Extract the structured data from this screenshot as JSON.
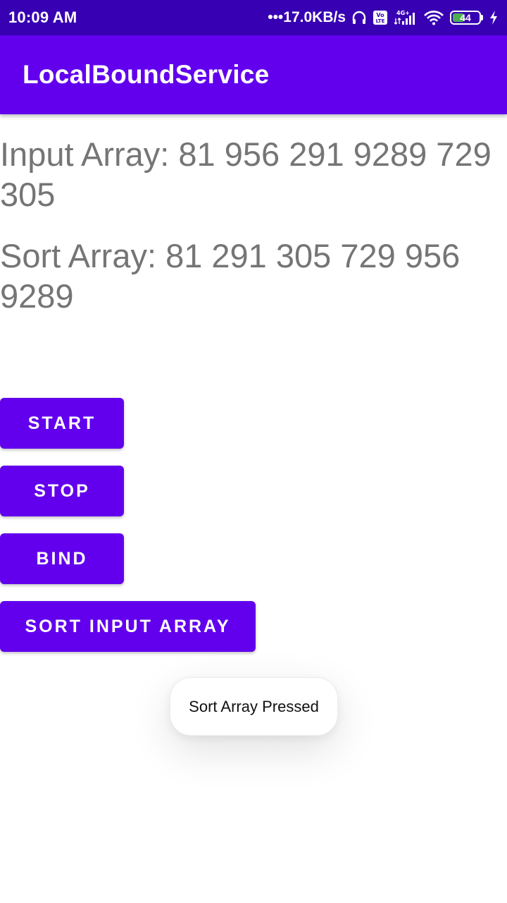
{
  "status_bar": {
    "time": "10:09 AM",
    "network_speed": "•••17.0KB/s",
    "battery_level": "44",
    "icons": [
      "headphones-icon",
      "volte-icon",
      "signal-4g-icon",
      "wifi-icon",
      "battery-icon",
      "charging-bolt-icon"
    ]
  },
  "app_bar": {
    "title": "LocalBoundService"
  },
  "main": {
    "input_array": "Input Array:  81 956 291 9289 729 305",
    "sort_array": "Sort Array:  81 291 305 729 956 9289"
  },
  "buttons": {
    "start": "START",
    "stop": "STOP",
    "bind": "BIND",
    "sort": "SORT INPUT ARRAY"
  },
  "toast": {
    "message": "Sort Array Pressed"
  },
  "colors": {
    "status_bar": "#3700b3",
    "primary": "#6200ee",
    "text_secondary": "#757575"
  }
}
